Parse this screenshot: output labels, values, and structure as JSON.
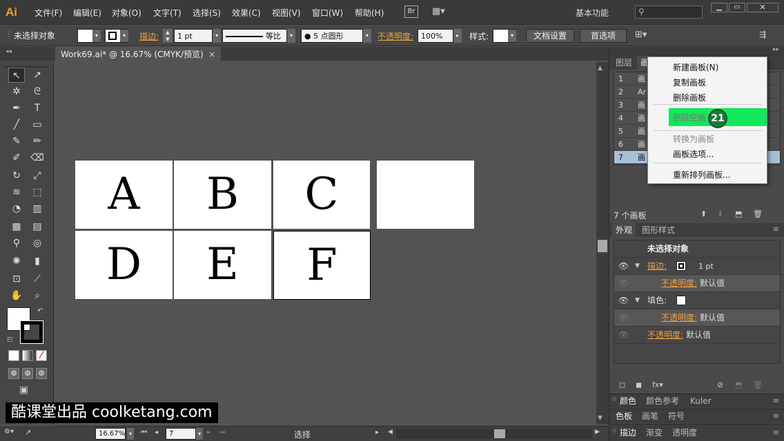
{
  "menubar": {
    "logo": "Ai",
    "items": [
      "文件(F)",
      "编辑(E)",
      "对象(O)",
      "文字(T)",
      "选择(S)",
      "效果(C)",
      "视图(V)",
      "窗口(W)",
      "帮助(H)"
    ],
    "br_label": "Br",
    "workspace": "基本功能",
    "search_placeholder": ""
  },
  "controlbar": {
    "selection_label": "未选择对象",
    "stroke_label": "描边:",
    "stroke_weight": "1 pt",
    "profile_label": "等比",
    "brush_label": "5 点圆形",
    "opacity_label": "不透明度:",
    "opacity_value": "100%",
    "style_label": "样式:",
    "doc_setup": "文档设置",
    "preferences": "首选项"
  },
  "document": {
    "tab_title": "Work69.ai* @ 16.67% (CMYK/预览)",
    "close_glyph": "×"
  },
  "artboards": [
    "A",
    "B",
    "C",
    "",
    "D",
    "E",
    "F"
  ],
  "status": {
    "zoom": "16.67%",
    "artboard_number": "7",
    "tool_label": "选择"
  },
  "artboards_panel": {
    "tabs": [
      "图层",
      "画"
    ],
    "rows": [
      {
        "num": "1",
        "name": "画"
      },
      {
        "num": "2",
        "name": "Ar"
      },
      {
        "num": "3",
        "name": "画"
      },
      {
        "num": "4",
        "name": "画"
      },
      {
        "num": "5",
        "name": "画"
      },
      {
        "num": "6",
        "name": "画"
      },
      {
        "num": "7",
        "name": "画"
      }
    ],
    "count": "7 个画板"
  },
  "popup_menu": {
    "items": [
      "新建画板(N)",
      "复制画板",
      "删除画板",
      "删除空画",
      "转换为画板",
      "画板选项...",
      "重新排列画板..."
    ],
    "step_badge": "21"
  },
  "appearance_panel": {
    "tabs": [
      "外观",
      "图形样式"
    ],
    "header": "未选择对象",
    "stroke_label": "描边:",
    "stroke_value": "1 pt",
    "opacity_label": "不透明度:",
    "opacity_value": "默认值",
    "fill_label": "填色:",
    "fill_opacity_label": "不透明度:",
    "fill_opacity_value": "默认值",
    "obj_opacity_label": "不透明度:",
    "obj_opacity_value": "默认值"
  },
  "bottom_panels": {
    "row1": [
      "颜色",
      "颜色参考",
      "Kuler"
    ],
    "row2": [
      "色板",
      "画笔",
      "符号"
    ],
    "row3": [
      "描边",
      "渐变",
      "透明度"
    ]
  },
  "watermark": "酷课堂出品 coolketang.com",
  "colors": {
    "accent_orange": "#f0a040",
    "highlight_green": "#12e85a",
    "badge_green": "#1a7a3a"
  }
}
